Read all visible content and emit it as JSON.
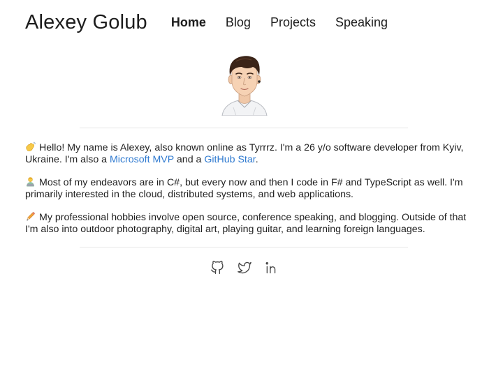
{
  "header": {
    "site_title": "Alexey Golub",
    "nav": [
      {
        "label": "Home",
        "active": true
      },
      {
        "label": "Blog",
        "active": false
      },
      {
        "label": "Projects",
        "active": false
      },
      {
        "label": "Speaking",
        "active": false
      }
    ]
  },
  "avatar": {
    "icon": "avatar-illustration"
  },
  "intro": {
    "p1": {
      "icon": "waving-hand-emoji",
      "text_a": "Hello! My name is Alexey, also known online as Tyrrrz. I'm a 26 y/o software developer from Kyiv, Ukraine. I'm also a ",
      "link1": "Microsoft MVP",
      "text_b": " and a ",
      "link2": "GitHub Star",
      "text_c": "."
    },
    "p2": {
      "icon": "technologist-emoji",
      "text": "Most of my endeavors are in C#, but every now and then I code in F# and TypeScript as well. I'm primarily interested in the cloud, distributed systems, and web applications."
    },
    "p3": {
      "icon": "pencil-emoji",
      "text": "My professional hobbies involve open source, conference speaking, and blogging. Outside of that I'm also into outdoor photography, digital art, playing guitar, and learning foreign languages."
    }
  },
  "socials": [
    {
      "icon": "github-icon"
    },
    {
      "icon": "twitter-icon"
    },
    {
      "icon": "linkedin-icon"
    }
  ],
  "colors": {
    "link": "#2f7ad0",
    "text": "#1f1f1f",
    "divider": "#e6e6e6",
    "icon": "#444444"
  }
}
